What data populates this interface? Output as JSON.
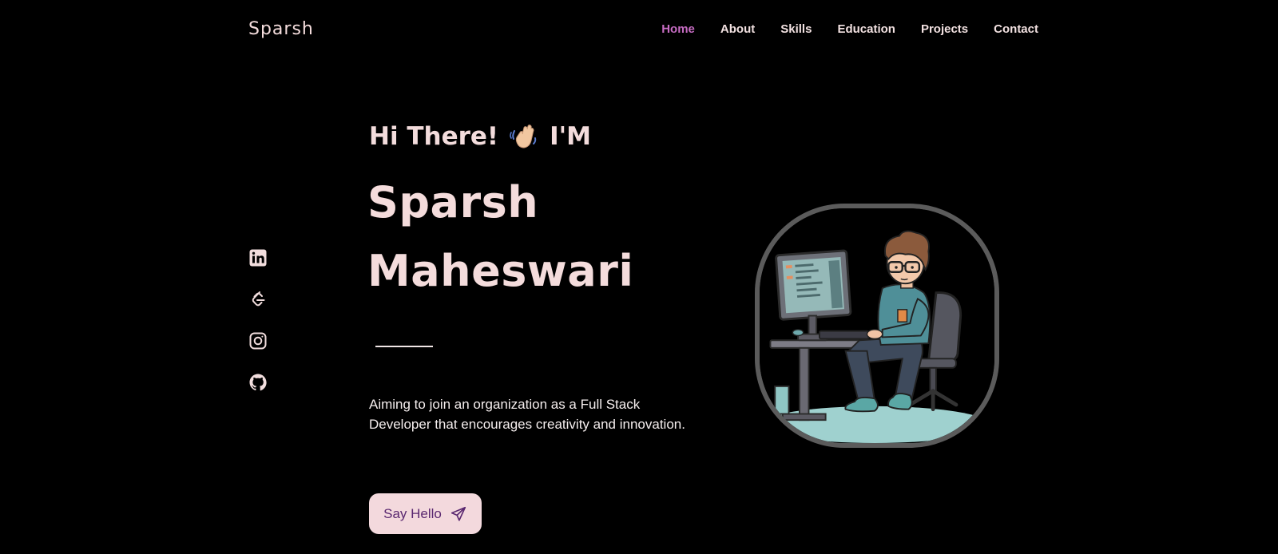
{
  "logo": "Sparsh",
  "nav": {
    "items": [
      {
        "label": "Home",
        "active": true
      },
      {
        "label": "About"
      },
      {
        "label": "Skills"
      },
      {
        "label": "Education"
      },
      {
        "label": "Projects"
      },
      {
        "label": "Contact"
      }
    ]
  },
  "hero": {
    "greeting_prefix": "Hi There!",
    "greeting_suffix": "I'M",
    "first_name": "Sparsh",
    "last_name": "Maheswari",
    "tagline": "Aiming to join an organization as a Full Stack Developer that encourages creativity and innovation.",
    "cta_label": "Say Hello"
  },
  "socials": [
    "linkedin-icon",
    "leetcode-icon",
    "instagram-icon",
    "github-icon"
  ],
  "colors": {
    "background": "#000000",
    "text": "#f2dede",
    "nav_active": "#c76cc3",
    "button_bg": "#f3d9dd",
    "button_text": "#5a2870"
  }
}
